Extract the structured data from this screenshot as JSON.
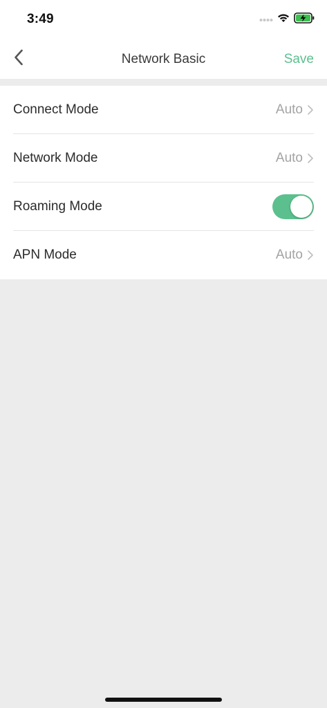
{
  "status_bar": {
    "time": "3:49",
    "icons": [
      "signal-dots-icon",
      "wifi-icon",
      "battery-charging-icon"
    ]
  },
  "nav": {
    "back_icon": "chevron-left-icon",
    "title": "Network Basic",
    "save_label": "Save"
  },
  "settings": [
    {
      "label": "Connect Mode",
      "value": "Auto",
      "type": "disclosure"
    },
    {
      "label": "Network Mode",
      "value": "Auto",
      "type": "disclosure"
    },
    {
      "label": "Roaming Mode",
      "type": "toggle",
      "on": true
    },
    {
      "label": "APN Mode",
      "value": "Auto",
      "type": "disclosure"
    }
  ],
  "colors": {
    "accent": "#5cc08e",
    "background": "#ececec",
    "card": "#ffffff",
    "value_text": "#a3a3a3"
  }
}
